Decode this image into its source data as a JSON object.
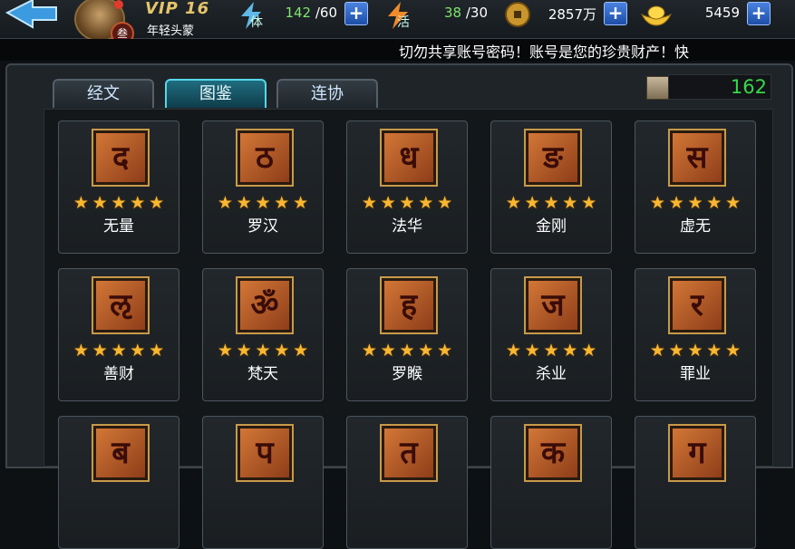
{
  "header": {
    "vip_label": "VIP 16",
    "rank_title": "年轻头蒙",
    "avatar_badge": "叁",
    "stamina": {
      "label": "体",
      "current": "142",
      "max": "/60"
    },
    "vigor": {
      "label": "活",
      "current": "38",
      "max": "/30"
    },
    "coins": "2857万",
    "gold": "5459",
    "plus": "+"
  },
  "notice": "切勿共享账号密码！账号是您的珍贵财产！快",
  "tabs": [
    "经文",
    "图鉴",
    "连协"
  ],
  "active_tab": "图鉴",
  "collection_count": "162",
  "cards": [
    {
      "name": "无量",
      "glyph": "द",
      "stars": 5
    },
    {
      "name": "罗汉",
      "glyph": "ठ",
      "stars": 5
    },
    {
      "name": "法华",
      "glyph": "ध",
      "stars": 5
    },
    {
      "name": "金刚",
      "glyph": "ङ",
      "stars": 5
    },
    {
      "name": "虚无",
      "glyph": "स",
      "stars": 5
    },
    {
      "name": "善财",
      "glyph": "ऌ",
      "stars": 5
    },
    {
      "name": "梵天",
      "glyph": "ॐ",
      "stars": 5
    },
    {
      "name": "罗睺",
      "glyph": "ह",
      "stars": 5
    },
    {
      "name": "杀业",
      "glyph": "ज",
      "stars": 5
    },
    {
      "name": "罪业",
      "glyph": "र",
      "stars": 5
    },
    {
      "name": "",
      "glyph": "ब",
      "stars": 0
    },
    {
      "name": "",
      "glyph": "प",
      "stars": 0
    },
    {
      "name": "",
      "glyph": "त",
      "stars": 0
    },
    {
      "name": "",
      "glyph": "क",
      "stars": 0
    },
    {
      "name": "",
      "glyph": "ग",
      "stars": 0
    }
  ],
  "star_char": "★",
  "colors": {
    "accent_green": "#37d84b",
    "star": "#f7b731",
    "tab_active": "#1f6d80",
    "plus": "#1d4ea8"
  },
  "icons": [
    "back-arrow-icon",
    "lightning-icon",
    "coin-icon",
    "gold-ingot-icon",
    "scroll-icon"
  ]
}
